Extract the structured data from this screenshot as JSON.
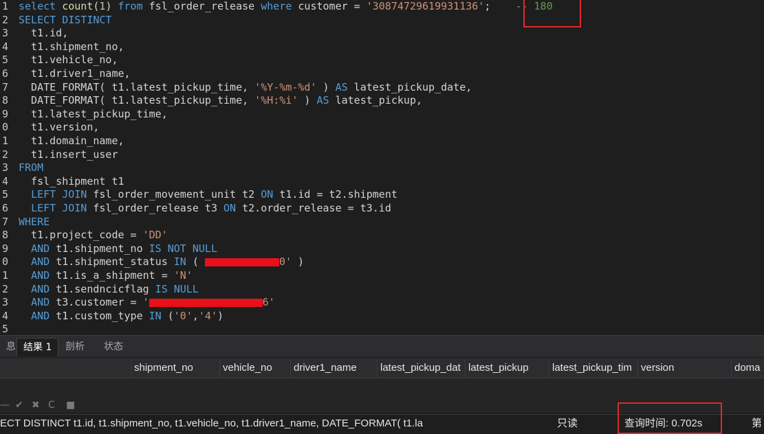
{
  "editor": {
    "annotation_comment": "-- 180",
    "lines": [
      {
        "ln": "1",
        "segs": [
          [
            "kw",
            "select "
          ],
          [
            "fn",
            "count"
          ],
          [
            "txt",
            "("
          ],
          [
            "num",
            "1"
          ],
          [
            "txt",
            ") "
          ],
          [
            "kw",
            "from "
          ],
          [
            "txt",
            "fsl_order_release "
          ],
          [
            "kw",
            "where "
          ],
          [
            "txt",
            "customer = "
          ],
          [
            "str",
            "'30874729619931136'"
          ],
          [
            "txt",
            ";  "
          ]
        ]
      },
      {
        "ln": "2",
        "segs": [
          [
            "kw",
            "SELECT DISTINCT"
          ]
        ]
      },
      {
        "ln": "3",
        "segs": [
          [
            "txt",
            "  t1.id,"
          ]
        ]
      },
      {
        "ln": "4",
        "segs": [
          [
            "txt",
            "  t1.shipment_no,"
          ]
        ]
      },
      {
        "ln": "5",
        "segs": [
          [
            "txt",
            "  t1.vehicle_no,"
          ]
        ]
      },
      {
        "ln": "6",
        "segs": [
          [
            "txt",
            "  t1.driver1_name,"
          ]
        ]
      },
      {
        "ln": "7",
        "segs": [
          [
            "txt",
            "  DATE_FORMAT( t1.latest_pickup_time, "
          ],
          [
            "str",
            "'%Y-%m-%d'"
          ],
          [
            "txt",
            " ) "
          ],
          [
            "kw",
            "AS "
          ],
          [
            "txt",
            "latest_pickup_date,"
          ]
        ]
      },
      {
        "ln": "8",
        "segs": [
          [
            "txt",
            "  DATE_FORMAT( t1.latest_pickup_time, "
          ],
          [
            "str",
            "'%H:%i'"
          ],
          [
            "txt",
            " ) "
          ],
          [
            "kw",
            "AS "
          ],
          [
            "txt",
            "latest_pickup,"
          ]
        ]
      },
      {
        "ln": "9",
        "segs": [
          [
            "txt",
            "  t1.latest_pickup_time,"
          ]
        ]
      },
      {
        "ln": "0",
        "segs": [
          [
            "txt",
            "  t1.version,"
          ]
        ]
      },
      {
        "ln": "1",
        "segs": [
          [
            "txt",
            "  t1.domain_name,"
          ]
        ]
      },
      {
        "ln": "2",
        "segs": [
          [
            "txt",
            "  t1.insert_user"
          ]
        ]
      },
      {
        "ln": "3",
        "segs": [
          [
            "kw",
            "FROM"
          ]
        ]
      },
      {
        "ln": "4",
        "segs": [
          [
            "txt",
            "  fsl_shipment t1"
          ]
        ]
      },
      {
        "ln": "5",
        "segs": [
          [
            "txt",
            "  "
          ],
          [
            "kw",
            "LEFT JOIN "
          ],
          [
            "txt",
            "fsl_order_movement_unit t2 "
          ],
          [
            "kw",
            "ON "
          ],
          [
            "txt",
            "t1.id = t2.shipment"
          ]
        ]
      },
      {
        "ln": "6",
        "segs": [
          [
            "txt",
            "  "
          ],
          [
            "kw",
            "LEFT JOIN "
          ],
          [
            "txt",
            "fsl_order_release t3 "
          ],
          [
            "kw",
            "ON "
          ],
          [
            "txt",
            "t2.order_release = t3.id"
          ]
        ]
      },
      {
        "ln": "7",
        "segs": [
          [
            "kw",
            "WHERE"
          ]
        ]
      },
      {
        "ln": "8",
        "segs": [
          [
            "txt",
            "  t1.project_code = "
          ],
          [
            "str",
            "'DD'"
          ]
        ]
      },
      {
        "ln": "9",
        "segs": [
          [
            "txt",
            "  "
          ],
          [
            "kw",
            "AND "
          ],
          [
            "txt",
            "t1.shipment_no "
          ],
          [
            "kw",
            "IS NOT NULL"
          ]
        ]
      },
      {
        "ln": "0",
        "segs": [
          [
            "txt",
            "  "
          ],
          [
            "kw",
            "AND "
          ],
          [
            "txt",
            "t1.shipment_status "
          ],
          [
            "kw",
            "IN "
          ],
          [
            "txt",
            "( "
          ],
          [
            "red",
            "108"
          ],
          [
            "str",
            "0'"
          ],
          [
            "txt",
            " )"
          ]
        ]
      },
      {
        "ln": "1",
        "segs": [
          [
            "txt",
            "  "
          ],
          [
            "kw",
            "AND "
          ],
          [
            "txt",
            "t1.is_a_shipment = "
          ],
          [
            "str",
            "'N'"
          ]
        ]
      },
      {
        "ln": "2",
        "segs": [
          [
            "txt",
            "  "
          ],
          [
            "kw",
            "AND "
          ],
          [
            "txt",
            "t1.sendncicflag "
          ],
          [
            "kw",
            "IS NULL"
          ]
        ]
      },
      {
        "ln": "3",
        "segs": [
          [
            "txt",
            "  "
          ],
          [
            "kw",
            "AND "
          ],
          [
            "txt",
            "t3.customer = "
          ],
          [
            "str",
            "'"
          ],
          [
            "red",
            "165"
          ],
          [
            "str",
            "6'"
          ]
        ]
      },
      {
        "ln": "4",
        "segs": [
          [
            "txt",
            "  "
          ],
          [
            "kw",
            "AND "
          ],
          [
            "txt",
            "t1.custom_type "
          ],
          [
            "kw",
            "IN "
          ],
          [
            "txt",
            "("
          ],
          [
            "str",
            "'0'"
          ],
          [
            "txt",
            ","
          ],
          [
            "str",
            "'4'"
          ],
          [
            "txt",
            ")"
          ]
        ]
      },
      {
        "ln": "5",
        "segs": []
      }
    ]
  },
  "tabs": [
    {
      "label": "息",
      "active": false
    },
    {
      "label": "结果 1",
      "active": true
    },
    {
      "label": "剖析",
      "active": false
    },
    {
      "label": "状态",
      "active": false
    }
  ],
  "grid": {
    "columns": [
      "shipment_no",
      "vehicle_no",
      "driver1_name",
      "latest_pickup_dat",
      "latest_pickup",
      "latest_pickup_tim",
      "version",
      "doma"
    ]
  },
  "toolbar": {
    "icons": [
      "minus-icon",
      "check-icon",
      "close-icon",
      "refresh-icon",
      "stop-icon"
    ],
    "glyphs": [
      "—",
      "✔",
      "✖",
      "C",
      "■"
    ]
  },
  "statusbar": {
    "query_preview": "ECT DISTINCT    t1.id,       t1.shipment_no,      t1.vehicle_no,        t1.driver1_name,     DATE_FORMAT( t1.la",
    "readonly": "只读",
    "query_time": "查询时间: 0.702s",
    "page": "第"
  },
  "colors": {
    "highlight_box": "#e3272d",
    "keyword": "#569cd6",
    "string": "#ce9178",
    "background": "#1e1e1e"
  }
}
